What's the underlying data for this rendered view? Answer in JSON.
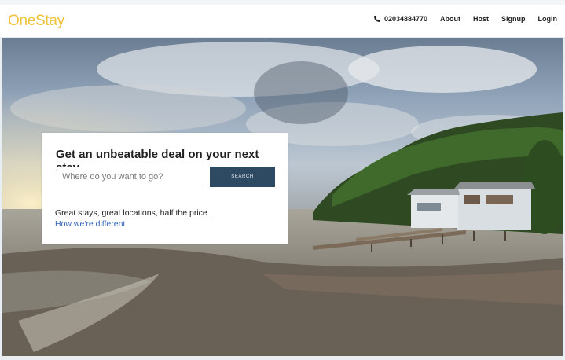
{
  "header": {
    "logo_text": "OneStay",
    "phone": "02034884770",
    "phone_icon": "phone-icon",
    "nav": [
      {
        "label": "About"
      },
      {
        "label": "Host"
      },
      {
        "label": "Signup"
      },
      {
        "label": "Login"
      }
    ]
  },
  "hero": {
    "headline": "Get an unbeatable deal on your next stay.",
    "search": {
      "placeholder": "Where do you want to go?",
      "value": "",
      "button_label": "SEARCH"
    },
    "tagline": "Great stays, great locations, half the price.",
    "link_text": "How we're different"
  },
  "colors": {
    "logo": "#f0c23a",
    "search_button": "#2e4a63",
    "link": "#3467b9"
  }
}
